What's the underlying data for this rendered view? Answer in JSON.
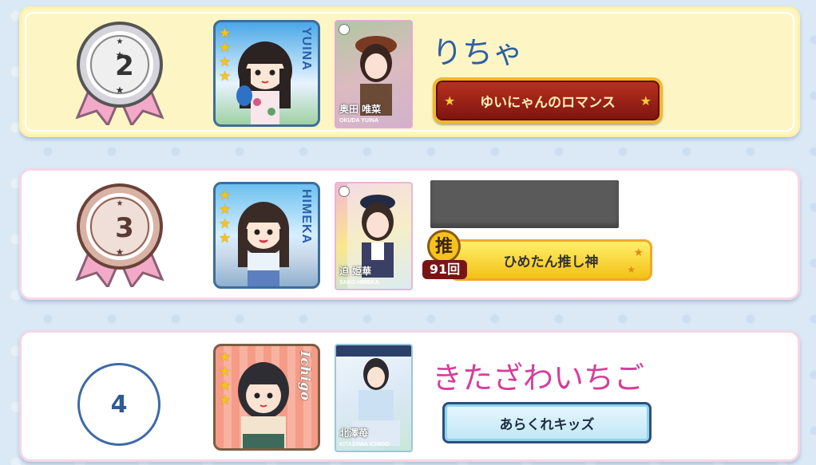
{
  "ranking": [
    {
      "rank": "2",
      "nickname": "りちゃ",
      "avatar_label": "YUINA",
      "card_name": "奥田 唯菜",
      "card_name_romaji": "OKUDA YUINA",
      "title": "ゆいにゃんのロマンス",
      "stars": 4
    },
    {
      "rank": "3",
      "nickname": "",
      "avatar_label": "HIMEKA",
      "card_name": "迫 姫華",
      "card_name_romaji": "SAKO HIMEKA",
      "title": "ひめたん推し神",
      "oshi_badge_kanji": "推",
      "oshi_badge_count": "91回",
      "stars": 4
    },
    {
      "rank": "4",
      "nickname": "きたざわいちご",
      "avatar_label": "Ichigo",
      "card_name": "北澤苺",
      "card_name_romaji": "KITAZAWA ICHIGO",
      "title": "あらくれキッズ",
      "stars": 4
    }
  ],
  "colors": {
    "silver_medal": "#c9c9cf",
    "bronze_medal": "#c59a8e",
    "ribbon": "#f3a9c8",
    "name_blue": "#2e5fa6",
    "name_pink": "#d63e9a",
    "title_red": "#8b1a1a",
    "title_gold": "#f4c518",
    "title_light_blue": "#bfe6f6"
  }
}
